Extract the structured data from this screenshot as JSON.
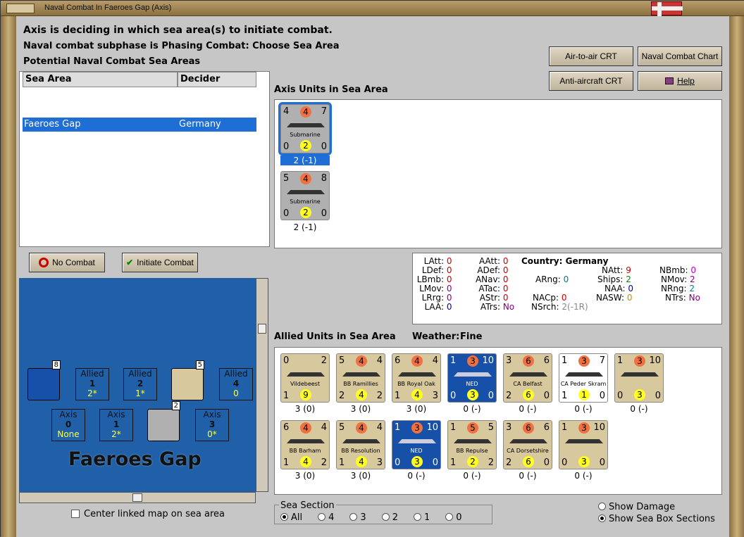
{
  "window": {
    "title": "Naval Combat In Faeroes Gap (Axis)"
  },
  "header": {
    "line1": "Axis is deciding in which sea area(s) to initiate combat.",
    "line2": "Naval combat subphase is Phasing Combat: Choose Sea Area",
    "line3": "Potential Naval Combat Sea Areas"
  },
  "buttons": {
    "air_to_air": "Air-to-air CRT",
    "naval_chart": "Naval Combat Chart",
    "anti_aircraft": "Anti-aircraft CRT",
    "help": "Help",
    "no_combat": "No Combat",
    "initiate_combat": "Initiate Combat"
  },
  "sea_table": {
    "columns": [
      "Sea Area",
      "Decider"
    ],
    "rows": [
      {
        "sea_area": "Faeroes Gap",
        "decider": "Germany"
      }
    ]
  },
  "axis_units": {
    "title": "Axis Units in Sea Area",
    "units": [
      {
        "tl": "4",
        "tc": "4",
        "tr": "7",
        "name": "Submarine",
        "bl": "0",
        "bc": "2",
        "br": "0",
        "caption": "2 (-1)",
        "style": "grey",
        "selected": true
      },
      {
        "tl": "5",
        "tc": "4",
        "tr": "8",
        "name": "Submarine",
        "bl": "0",
        "bc": "2",
        "br": "0",
        "caption": "2 (-1)",
        "style": "grey",
        "selected": false
      }
    ]
  },
  "stats": {
    "country_label": "Country:",
    "country": "Germany",
    "LAtt": "0",
    "LDef": "0",
    "LBmb": "0",
    "LMov": "0",
    "LRrg": "0",
    "LAA": "0",
    "AAtt": "0",
    "ADef": "0",
    "ANav": "0",
    "ATac": "0",
    "AStr": "0",
    "ATrs": "No",
    "ARng": "0",
    "NACp": "0",
    "NSrch": "2(-1R)",
    "NAtt": "9",
    "Ships": "2",
    "NAA": "0",
    "NASW": "0",
    "NBmb": "0",
    "NMov": "2",
    "NRng": "2",
    "NTrs": "No"
  },
  "allied_units": {
    "title": "Allied Units in Sea Area",
    "weather_label": "Weather:",
    "weather": "Fine",
    "units": [
      {
        "tl": "0",
        "tc": "",
        "tr": "2",
        "name": "Vildebeest",
        "bl": "1",
        "bc": "9",
        "br": "",
        "caption": "3 (0)",
        "style": "tan"
      },
      {
        "tl": "5",
        "tc": "4",
        "tr": "4",
        "name": "BB Ramillies",
        "bl": "2",
        "bc": "4",
        "br": "2",
        "caption": "3 (0)",
        "style": "tan"
      },
      {
        "tl": "6",
        "tc": "4",
        "tr": "4",
        "name": "BB Royal Oak",
        "bl": "1",
        "bc": "4",
        "br": "3",
        "caption": "3 (0)",
        "style": "tan"
      },
      {
        "tl": "1",
        "tc": "3",
        "tr": "10",
        "name": "NED",
        "bl": "0",
        "bc": "3",
        "br": "0",
        "caption": "0 (-)",
        "style": "blue"
      },
      {
        "tl": "3",
        "tc": "6",
        "tr": "6",
        "name": "CA Belfast",
        "bl": "2",
        "bc": "6",
        "br": "0",
        "caption": "0 (-)",
        "style": "tan"
      },
      {
        "tl": "1",
        "tc": "3",
        "tr": "7",
        "name": "CA Peder Skram",
        "bl": "1",
        "bc": "1",
        "br": "0",
        "caption": "0 (-)",
        "style": "white"
      },
      {
        "tl": "1",
        "tc": "3",
        "tr": "10",
        "name": "",
        "bl": "0",
        "bc": "3",
        "br": "0",
        "caption": "0 (-)",
        "style": "tan"
      },
      {
        "tl": "6",
        "tc": "4",
        "tr": "4",
        "name": "BB Barham",
        "bl": "1",
        "bc": "4",
        "br": "2",
        "caption": "3 (0)",
        "style": "tan"
      },
      {
        "tl": "5",
        "tc": "4",
        "tr": "4",
        "name": "BB Resolution",
        "bl": "1",
        "bc": "4",
        "br": "3",
        "caption": "3 (0)",
        "style": "tan"
      },
      {
        "tl": "1",
        "tc": "3",
        "tr": "10",
        "name": "NED",
        "bl": "0",
        "bc": "3",
        "br": "0",
        "caption": "0 (-)",
        "style": "blue"
      },
      {
        "tl": "1",
        "tc": "5",
        "tr": "5",
        "name": "BB Repulse",
        "bl": "1",
        "bc": "2",
        "br": "2",
        "caption": "0 (-)",
        "style": "tan"
      },
      {
        "tl": "3",
        "tc": "6",
        "tr": "6",
        "name": "CA Dorsetshire",
        "bl": "2",
        "bc": "6",
        "br": "0",
        "caption": "0 (-)",
        "style": "tan"
      },
      {
        "tl": "1",
        "tc": "3",
        "tr": "10",
        "name": "",
        "bl": "0",
        "bc": "3",
        "br": "0",
        "caption": "0 (-)",
        "style": "tan"
      }
    ]
  },
  "map": {
    "name": "Faeroes Gap",
    "allied_boxes": [
      {
        "label": "Allied",
        "num": "1",
        "val": "2*"
      },
      {
        "label": "Allied",
        "num": "2",
        "val": "1*"
      },
      {
        "label": "Allied",
        "num": "4",
        "val": "0"
      }
    ],
    "axis_boxes": [
      {
        "label": "Axis",
        "num": "0",
        "val": "None"
      },
      {
        "label": "Axis",
        "num": "1",
        "val": "2*"
      },
      {
        "label": "Axis",
        "num": "3",
        "val": "0*"
      }
    ],
    "stack_counts": [
      "8",
      "5",
      "2"
    ],
    "center_checkbox": "Center linked map on sea area"
  },
  "sea_section": {
    "title": "Sea Section",
    "options": [
      "All",
      "4",
      "3",
      "2",
      "1",
      "0"
    ],
    "selected": "All"
  },
  "display_options": {
    "show_damage": "Show Damage",
    "show_boxes": "Show Sea Box Sections",
    "selected": "show_boxes"
  },
  "colors": {
    "selection": "#1e6ed6",
    "attack_circle": "#f07040",
    "defense_circle": "#ffff20",
    "map_sea": "#2060a8"
  }
}
